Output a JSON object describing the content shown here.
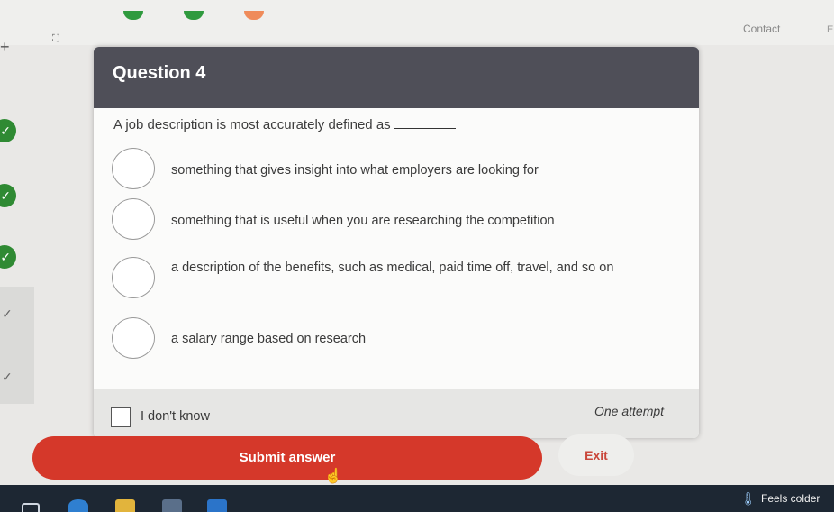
{
  "topbar": {
    "contact_label": "Contact",
    "edge_label": "E",
    "plus_glyph": "+",
    "expand_glyph": "⛶"
  },
  "progress_rail": {
    "check_glyph": "✓",
    "tick_glyph": "✓"
  },
  "quiz": {
    "title": "Question 4",
    "question": "A job description is most accurately defined as",
    "options": [
      {
        "label": "something that gives insight into what employers are looking for"
      },
      {
        "label": "something that is useful when you are researching the competition"
      },
      {
        "label": "a description of the benefits, such as medical, paid time off, travel, and so on"
      },
      {
        "label": "a salary range based on research"
      }
    ],
    "dont_know_label": "I don't know",
    "attempts_label": "One attempt",
    "submit_label": "Submit answer",
    "exit_label": "Exit"
  },
  "taskbar": {
    "weather_label": "Feels colder",
    "weather_icon": "thermometer-icon"
  },
  "colors": {
    "header": "#4f4f58",
    "submit": "#d5382a",
    "exit_text": "#c9463a",
    "check": "#2f8a33"
  }
}
